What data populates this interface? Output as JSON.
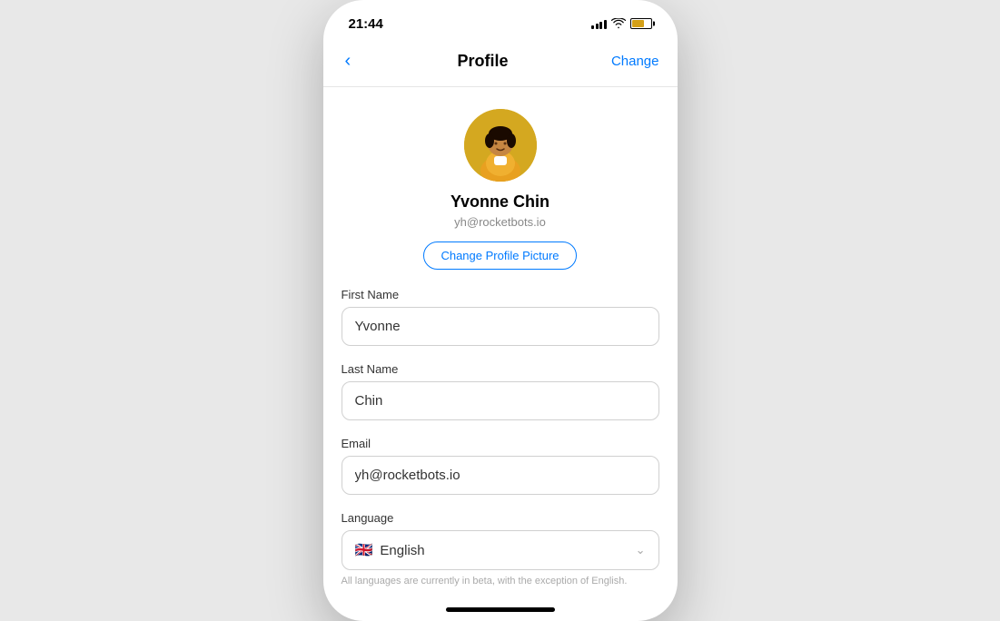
{
  "statusBar": {
    "time": "21:44"
  },
  "navBar": {
    "backLabel": "‹",
    "title": "Profile",
    "actionLabel": "Change"
  },
  "profile": {
    "name": "Yvonne Chin",
    "email": "yh@rocketbots.io",
    "changePictureLabel": "Change Profile Picture"
  },
  "form": {
    "firstNameLabel": "First Name",
    "firstNameValue": "Yvonne",
    "lastNameLabel": "Last Name",
    "lastNameValue": "Chin",
    "emailLabel": "Email",
    "emailValue": "yh@rocketbots.io",
    "languageLabel": "Language",
    "languageValue": "English",
    "languageFlagEmoji": "🇬🇧",
    "languageNote": "All languages are currently in beta, with the exception of English."
  }
}
